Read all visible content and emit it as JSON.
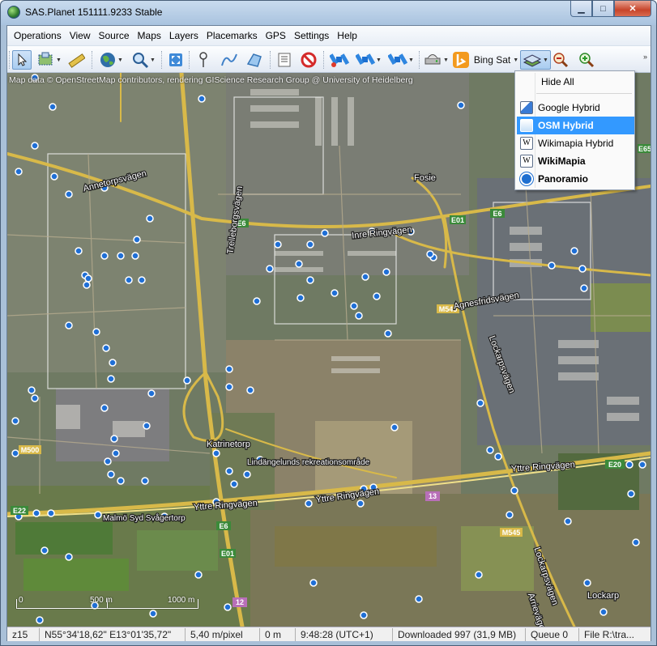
{
  "window": {
    "title": "SAS.Planet 151111.9233 Stable",
    "min": "▁",
    "max": "□",
    "close": "✕"
  },
  "menu": [
    "Operations",
    "View",
    "Source",
    "Maps",
    "Layers",
    "Placemarks",
    "GPS",
    "Settings",
    "Help"
  ],
  "toolbar": {
    "map_source_label": "Bing Sat",
    "more": "»"
  },
  "layers_menu": {
    "hide_all": "Hide All",
    "items": [
      {
        "label": "Google Hybrid",
        "icon": "google-icon",
        "bold": false,
        "highlighted": false
      },
      {
        "label": "OSM Hybrid",
        "icon": "osm-icon",
        "bold": true,
        "highlighted": true
      },
      {
        "label": "Wikimapia Hybrid",
        "icon": "wikimapia-icon",
        "bold": false,
        "highlighted": false
      },
      {
        "label": "WikiMapia",
        "icon": "wikimapia-icon",
        "bold": true,
        "highlighted": false
      },
      {
        "label": "Panoramio",
        "icon": "panoramio-icon",
        "bold": true,
        "highlighted": false
      }
    ]
  },
  "map": {
    "attribution": "Map data © OpenStreetMap contributors, rendering GIScience Research Group @ University of Heidelberg",
    "place_labels": [
      "Annetorpsvägen",
      "Trelleborgsvägen",
      "Inre Ringvägen",
      "Agnesfridsvägen",
      "Lockarpsvägen",
      "Katrinetorp",
      "Lindängelunds rekreationsområde",
      "Yttre Ringvägen",
      "Malmö Syd Svågertorp",
      "Lockarp",
      "Fosie",
      "Arrievägen"
    ],
    "road_shields": [
      "E6",
      "E01",
      "E65",
      "M545",
      "M500",
      "E20",
      "E22",
      "13",
      "12"
    ],
    "scale": {
      "zero": "0",
      "mid": "500 m",
      "end": "1000 m"
    }
  },
  "status": {
    "zoom": "z15",
    "coords": "N55°34'18,62\" E13°01'35,72\"",
    "resolution": "5,40 m/pixel",
    "altitude": "0 m",
    "time": "9:48:28 (UTC+1)",
    "downloaded": "Downloaded 997 (31,9 MB)",
    "queue": "Queue 0",
    "file": "File R:\\tra..."
  },
  "colors": {
    "highlight": "#3399ff",
    "poi_marker": "#1f6fd6",
    "road_yellow": "#d8b949"
  }
}
